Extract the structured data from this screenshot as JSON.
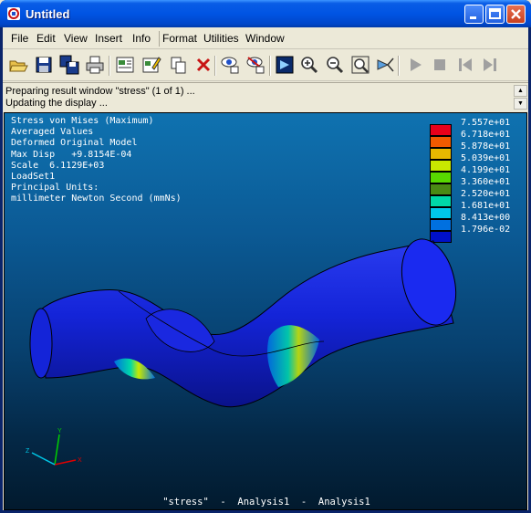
{
  "window": {
    "title": "Untitled"
  },
  "menu": [
    "File",
    "Edit",
    "View",
    "Insert",
    "Info",
    "Format",
    "Utilities",
    "Window"
  ],
  "status": {
    "line1": "Preparing result window \"stress\" (1 of 1) ...",
    "line2": "Updating the display ..."
  },
  "info": {
    "line1": "Stress von Mises (Maximum)",
    "line2": "Averaged Values",
    "line3": "Deformed Original Model",
    "line4": "Max Disp   +9.8154E-04",
    "line5": "Scale  6.1129E+03",
    "line6": "LoadSet1",
    "line7": "Principal Units:",
    "line8": "millimeter Newton Second (mmNs)"
  },
  "legend": [
    {
      "value": "7.557e+01",
      "color": "#e8001a"
    },
    {
      "value": "6.718e+01",
      "color": "#f05a00"
    },
    {
      "value": "5.878e+01",
      "color": "#e8b800"
    },
    {
      "value": "5.039e+01",
      "color": "#c8e800"
    },
    {
      "value": "4.199e+01",
      "color": "#58d800"
    },
    {
      "value": "3.360e+01",
      "color": "#4a8a14"
    },
    {
      "value": "2.520e+01",
      "color": "#00d8a8"
    },
    {
      "value": "1.681e+01",
      "color": "#00c8e8"
    },
    {
      "value": "8.413e+00",
      "color": "#0070e0"
    },
    {
      "value": "1.796e-02",
      "color": "#0010c8"
    }
  ],
  "footer": "\"stress\"  -  Analysis1  -  Analysis1",
  "triad": {
    "x": "X",
    "y": "Y",
    "z": "Z"
  }
}
